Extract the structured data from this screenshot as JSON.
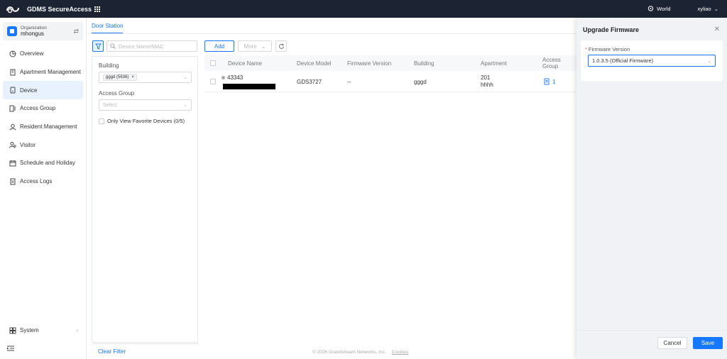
{
  "app": {
    "title": "GDMS SecureAccess"
  },
  "topbar": {
    "region": "World",
    "user": "xyliao"
  },
  "org": {
    "label": "Organization",
    "name": "mhongus"
  },
  "nav": {
    "items": [
      {
        "label": "Overview",
        "icon": "overview-icon"
      },
      {
        "label": "Apartment Management",
        "icon": "building-icon"
      },
      {
        "label": "Device",
        "icon": "device-icon",
        "active": true
      },
      {
        "label": "Access Group",
        "icon": "access-group-icon"
      },
      {
        "label": "Resident Management",
        "icon": "resident-icon"
      },
      {
        "label": "Visitor",
        "icon": "visitor-icon"
      },
      {
        "label": "Schedule and Holiday",
        "icon": "calendar-icon"
      },
      {
        "label": "Access Logs",
        "icon": "logs-icon"
      }
    ],
    "system": "System"
  },
  "main": {
    "tab": "Door Station",
    "search_placeholder": "Device Name/MAC",
    "filter": {
      "building_label": "Building",
      "building_tag": "gggd (5636)",
      "access_group_label": "Access Group",
      "access_group_placeholder": "Select",
      "favorites_label": "Only View Favorite Devices (0/5)",
      "clear_label": "Clear Filter"
    },
    "toolbar": {
      "add": "Add",
      "more": "More"
    },
    "table": {
      "headers": [
        "Device Name",
        "Device Model",
        "Firmware Version",
        "Building",
        "Apartment",
        "Access Group"
      ],
      "rows": [
        {
          "name": "43343",
          "model": "GDS3727",
          "firmware": "--",
          "building": "gggd",
          "apartment_1": "201",
          "apartment_2": "hhhh",
          "access_group": "1"
        }
      ]
    },
    "footer": {
      "copyright": "© 2026 Grandstream Networks, Inc.",
      "cookies": "Cookies"
    }
  },
  "drawer": {
    "title": "Upgrade Firmware",
    "field_label": "Firmware Version",
    "field_value": "1.0.3.5 (Official Firmware)",
    "cancel": "Cancel",
    "save": "Save"
  },
  "colors": {
    "primary": "#1677ff",
    "topbar": "#1c2433"
  }
}
